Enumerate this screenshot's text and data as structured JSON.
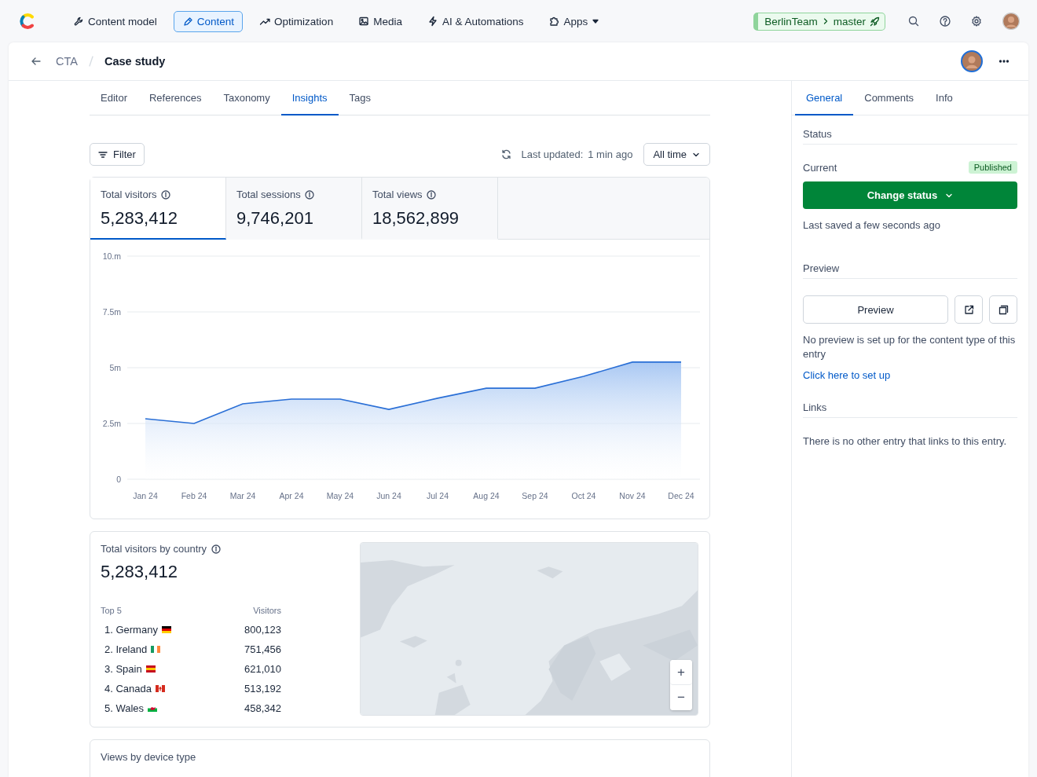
{
  "top_nav": {
    "items": [
      {
        "label": "Content model",
        "selected": false,
        "kind": "link"
      },
      {
        "label": "Content",
        "selected": true,
        "kind": "link"
      },
      {
        "label": "Optimization",
        "selected": false,
        "kind": "link"
      },
      {
        "label": "Media",
        "selected": false,
        "kind": "link"
      },
      {
        "label": "AI & Automations",
        "selected": false,
        "kind": "link"
      },
      {
        "label": "Apps",
        "selected": false,
        "kind": "menu"
      }
    ],
    "branch": {
      "space": "BerlinTeam",
      "environment": "master"
    }
  },
  "header": {
    "breadcrumb": "CTA",
    "title": "Case study"
  },
  "tabs": [
    {
      "label": "Editor",
      "selected": false
    },
    {
      "label": "References",
      "selected": false
    },
    {
      "label": "Taxonomy",
      "selected": false
    },
    {
      "label": "Insights",
      "selected": true
    },
    {
      "label": "Tags",
      "selected": false
    }
  ],
  "toolbar": {
    "filter": "Filter",
    "updated_label": "Last updated:",
    "updated_value": "1 min ago",
    "range": "All time"
  },
  "metrics": [
    {
      "label": "Total visitors",
      "value": "5,283,412",
      "selected": true
    },
    {
      "label": "Total sessions",
      "value": "9,746,201",
      "selected": false
    },
    {
      "label": "Total views",
      "value": "18,562,899",
      "selected": false
    }
  ],
  "chart": {
    "chart_data": {
      "type": "area",
      "categories": [
        "Jan 24",
        "Feb 24",
        "Mar 24",
        "Apr 24",
        "May 24",
        "Jun 24",
        "Jul 24",
        "Aug 24",
        "Sep 24",
        "Oct 24",
        "Nov 24",
        "Dec 24"
      ],
      "series": [
        {
          "color": "#2a6fd6",
          "values": [
            2.71,
            2.5,
            3.38,
            3.59,
            3.59,
            3.13,
            3.63,
            4.08,
            4.08,
            4.61,
            5.25,
            5.25
          ]
        }
      ],
      "ylim": [
        0,
        10
      ],
      "grid": true,
      "yticks": [
        0,
        {
          "value": 2.5,
          "label": "2.5m"
        },
        {
          "value": 5,
          "label": "5m"
        },
        {
          "value": 7.5,
          "label": "7.5m"
        },
        {
          "value": 10,
          "label": "10.m"
        }
      ]
    }
  },
  "country_card": {
    "title": "Total visitors by country",
    "total": "5,283,412",
    "columns": [
      "Top 5",
      "Visitors"
    ],
    "rows": [
      {
        "country": "1. Germany",
        "visitors": "800,123"
      },
      {
        "country": "2. Ireland",
        "visitors": "751,456"
      },
      {
        "country": "3. Spain",
        "visitors": "621,010"
      },
      {
        "country": "4. Canada",
        "visitors": "513,192"
      },
      {
        "country": "5. Wales",
        "visitors": "458,342"
      }
    ],
    "map": {
      "kind": "picture",
      "zoom_in": "+",
      "zoom_out": "−"
    }
  },
  "device_card": {
    "title": "Views by device type"
  },
  "side_tabs": [
    {
      "label": "General",
      "selected": true
    },
    {
      "label": "Comments",
      "selected": false
    },
    {
      "label": "Info",
      "selected": false
    }
  ],
  "status": {
    "heading": "Status",
    "current_label": "Current",
    "badge": "Published",
    "button": "Change status",
    "saved": "Last saved a few seconds ago"
  },
  "preview": {
    "heading": "Preview",
    "button": "Preview",
    "note": "No preview is set up for the content type of this entry",
    "link": "Click here to set up"
  },
  "links": {
    "heading": "Links",
    "note": "There is no other entry that links to this entry."
  }
}
